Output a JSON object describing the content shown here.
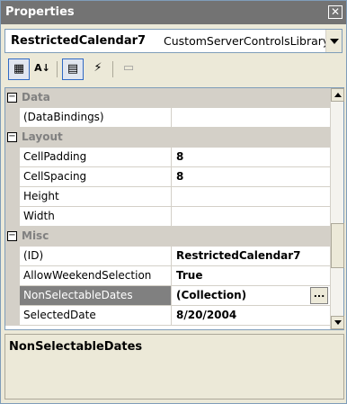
{
  "window": {
    "title": "Properties",
    "close_glyph": "✕"
  },
  "selector": {
    "object_name": "RestrictedCalendar7",
    "object_type": "CustomServerControlsLibrary."
  },
  "toolbar": {
    "buttons": [
      {
        "name": "categorized-view",
        "icon": "categorized-icon",
        "glyph": "▦",
        "state": "pressed"
      },
      {
        "name": "alphabetical-view",
        "icon": "alphabetical-icon",
        "glyph": "A↓",
        "state": "normal"
      },
      {
        "name": "properties-view",
        "icon": "properties-icon",
        "glyph": "▤",
        "state": "pressed"
      },
      {
        "name": "events-view",
        "icon": "lightning-icon",
        "glyph": "⚡",
        "state": "normal"
      },
      {
        "name": "property-pages",
        "icon": "property-pages-icon",
        "glyph": "▭",
        "state": "disabled"
      }
    ]
  },
  "grid": {
    "categories": [
      {
        "label": "Data",
        "expander": "−"
      },
      {
        "label": "Layout",
        "expander": "−"
      },
      {
        "label": "Misc",
        "expander": "−"
      }
    ],
    "rows": [
      {
        "name": "(DataBindings)",
        "value": ""
      },
      {
        "name": "CellPadding",
        "value": "8"
      },
      {
        "name": "CellSpacing",
        "value": "8"
      },
      {
        "name": "Height",
        "value": ""
      },
      {
        "name": "Width",
        "value": ""
      },
      {
        "name": "(ID)",
        "value": "RestrictedCalendar7"
      },
      {
        "name": "AllowWeekendSelection",
        "value": "True"
      },
      {
        "name": "NonSelectableDates",
        "value": "(Collection)",
        "selected": true
      },
      {
        "name": "SelectedDate",
        "value": "8/20/2004"
      }
    ],
    "ellipsis_label": "..."
  },
  "description": {
    "title": "NonSelectableDates"
  },
  "colors": {
    "title_bar": "#737373",
    "category_bg": "#d4d0c8",
    "selected_row": "#808080",
    "panel_bg": "#ece9d8"
  }
}
